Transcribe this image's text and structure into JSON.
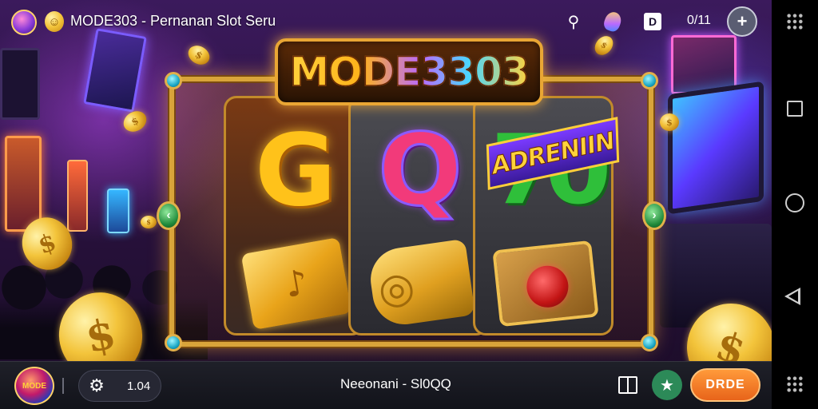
{
  "topbar": {
    "title": "MODE303 - Pernanan Slot  Seru",
    "share_icon": "share-icon",
    "mascot_icon": "mascot-icon",
    "d_button_label": "D",
    "menu_text": "0/11",
    "add_button_label": "+"
  },
  "game": {
    "logo_text": "MODE3303",
    "banner_text": "ADRENIIN",
    "reels": [
      {
        "top_symbol": "G",
        "bottom_symbol": "gold-box-icon"
      },
      {
        "top_symbol": "Q",
        "bottom_symbol": "gold-scroll-icon"
      },
      {
        "top_symbol": "70",
        "bottom_symbol": "ruby-chest-icon"
      }
    ],
    "nav_left": "‹",
    "nav_right": "›"
  },
  "bottombar": {
    "badge_text": "MODE",
    "gear_icon": "⚙",
    "value": "1.04",
    "center_text": "Neeonani - Sl0QQ",
    "star_icon": "★",
    "action_label": "DRDE"
  },
  "colors": {
    "accent_gold": "#d9a43a",
    "action_orange": "#f07a22",
    "star_green": "#2c8a58",
    "bottombar_bg": "#1b1c24"
  }
}
